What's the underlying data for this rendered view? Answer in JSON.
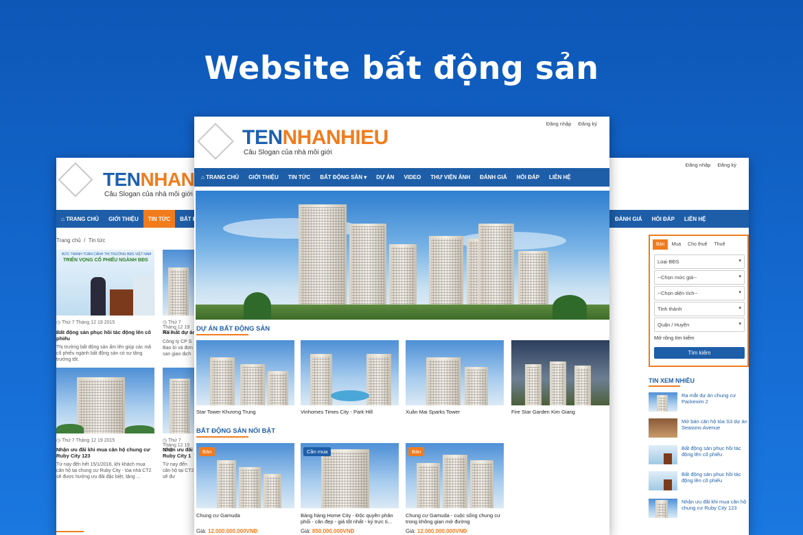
{
  "hero_title": "Website bất động sản",
  "brand": {
    "part1": "TEN",
    "part2": "NHANHIEU",
    "slogan": "Câu Slogan của nhà môi giới"
  },
  "auth": {
    "login": "Đăng nhập",
    "register": "Đăng ký"
  },
  "nav": {
    "home": "TRANG CHỦ",
    "intro": "GIỚI THIỆU",
    "news": "TIN TỨC",
    "realestate": "BẤT ĐỘNG SẢN",
    "realestate_short": "BẤT Đ",
    "projects": "DỰ ÁN",
    "video": "VIDEO",
    "gallery": "THƯ VIỆN ẢNH",
    "reviews": "ĐÁNH GIÁ",
    "qa": "HỎI ĐÁP",
    "contact": "LIÊN HỆ"
  },
  "breadcrumb": {
    "home": "Trang chủ",
    "sep": "/",
    "current": "Tin tức"
  },
  "left_news": [
    {
      "date": "Thứ 7 Tháng 12 19 2015",
      "title": "Bất động sản phục hồi tác động lên cổ phiếu",
      "desc": "Thị trường bất động sản ấm lên giúp các mã cổ phiếu ngành bất động sản có sự tăng trưởng tốt.",
      "img_text1": "BỨC TRANH TOÀN CẢNH THỊ TRƯỜNG BĐS VIỆT NAM",
      "img_text2": "TRIỂN VỌNG CỔ PHIẾU NGÀNH BĐS"
    },
    {
      "date": "Thứ 7 Tháng 12 19 2015",
      "title": "Ra mắt dự án",
      "desc": "Công ty CP S Bao bì và đơn san giao dịch"
    },
    {
      "date": "Thứ 7 Tháng 12 19 2015",
      "title": "Nhận ưu đãi khi mua căn hộ chung cư Ruby City 123",
      "desc": "Từ nay đến hết 15/1/2016, khi khách mua căn hộ tại chung cư Ruby City - tòa nhà CT2 sẽ được hưởng ưu đãi đặc biệt, tặng ..."
    },
    {
      "date": "Thứ 7 Tháng 12 19 2015",
      "title": "Nhận ưu đãi Ruby City 1",
      "desc": "Từ nay đến căn hộ tại CT2 sẽ đư"
    }
  ],
  "sections": {
    "projects": "DỰ ÁN BẤT ĐỘNG SẢN",
    "featured": "BẤT ĐỘNG SẢN NỔI BẬT",
    "most_viewed": "TIN XEM NHIỀU"
  },
  "projects": [
    "Star Tower Khương Trung",
    "Vinhomes Times City - Park Hill",
    "Xuân Mai Sparks Tower",
    "Fire Star Garden Kim Giang"
  ],
  "featured": [
    {
      "badge": "Bán",
      "title": "Chung cư Gamuda",
      "price_label": "Giá:",
      "price": "12.000.000.000VNĐ"
    },
    {
      "badge": "Cần mua",
      "title": "Bàng hàng Home City - Độc quyền phân phối - căn đẹp - giá tốt nhất - ký trực ti...",
      "price_label": "Giá:",
      "price": "850.000.000VNĐ"
    },
    {
      "badge": "Bán",
      "title": "Chung cư Gamuda - cuộc sống chung cư trong không gian mở đường",
      "price_label": "Giá:",
      "price": "12.000.000.000VNĐ"
    }
  ],
  "search": {
    "tabs": [
      "Bán",
      "Mua",
      "Cho thuê",
      "Thuê"
    ],
    "type": "Loại BĐS",
    "price": "--Chọn mức giá--",
    "area": "--Chọn diện tích--",
    "province": "Tỉnh thành",
    "district": "Quận / Huyện",
    "expand": "Mở rộng tìm kiếm",
    "button": "Tìm kiếm"
  },
  "most_viewed": [
    "Ra mắt dự án chung cư Packexim 2",
    "Mở bán căn hộ tòa S3 dự án Seasons Avenue",
    "Bất động sản phục hồi tác động lên cổ phiếu",
    "Bất động sản phục hồi tác động lên cổ phiếu",
    "Nhận ưu đãi khi mua căn hộ chung cư Ruby City 123"
  ],
  "colors": {
    "primary": "#1e5ea8",
    "accent": "#f07c1e",
    "bg": "#0d57b7"
  }
}
